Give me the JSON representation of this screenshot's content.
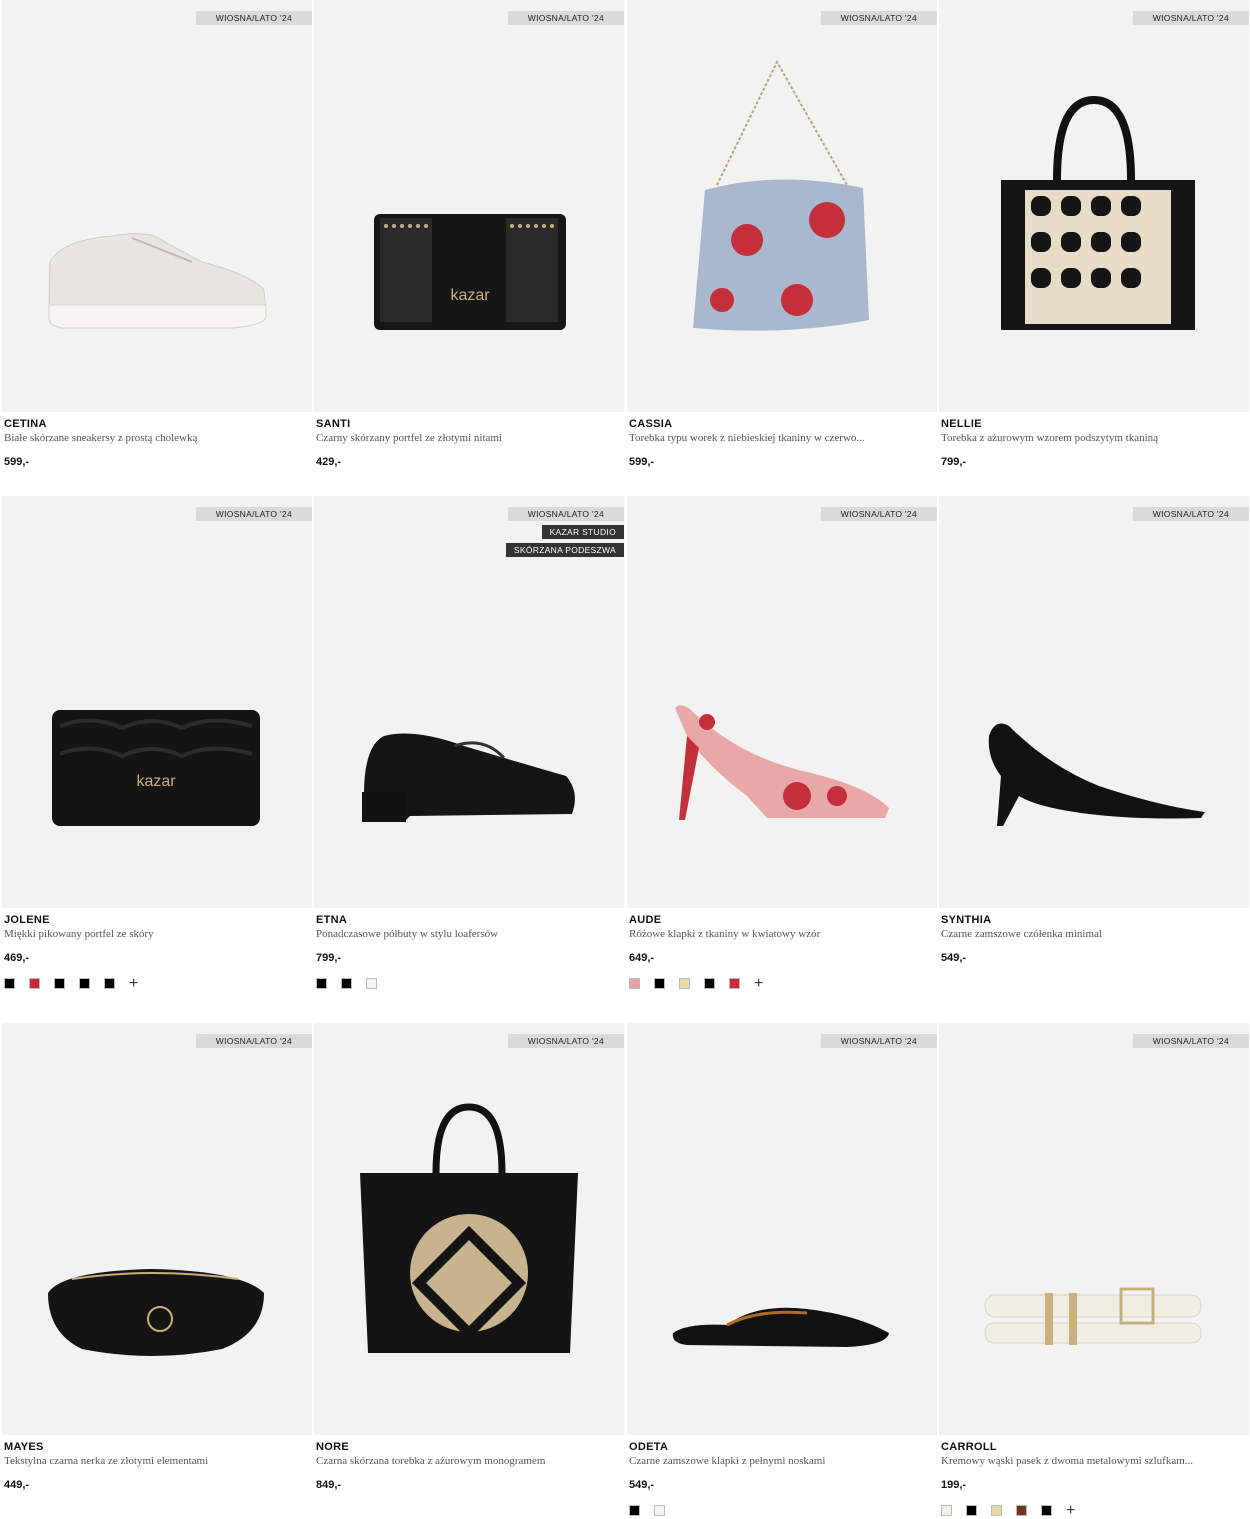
{
  "products": [
    {
      "name": "CETINA",
      "desc": "Białe skórzane sneakersy z prostą cholewką",
      "price": "599,-",
      "badges": [
        "WIOSNA/LATO '24"
      ],
      "swatches": []
    },
    {
      "name": "SANTI",
      "desc": "Czarny skórzany portfel ze złotymi nitami",
      "price": "429,-",
      "badges": [
        "WIOSNA/LATO '24"
      ],
      "swatches": [],
      "logo": "kazar"
    },
    {
      "name": "CASSIA",
      "desc": "Torebka typu worek z niebieskiej tkaniny w czerwo...",
      "price": "599,-",
      "badges": [
        "WIOSNA/LATO '24"
      ],
      "swatches": []
    },
    {
      "name": "NELLIE",
      "desc": "Torebka z ażurowym wzorem podszytym tkaniną",
      "price": "799,-",
      "badges": [
        "WIOSNA/LATO '24"
      ],
      "swatches": []
    },
    {
      "name": "JOLENE",
      "desc": "Miękki pikowany portfel ze skóry",
      "price": "469,-",
      "badges": [
        "WIOSNA/LATO '24"
      ],
      "swatches": [
        "#000000",
        "#c8283a",
        "#000000",
        "#000000",
        "#000000"
      ],
      "more": "+",
      "logo": "kazar"
    },
    {
      "name": "ETNA",
      "desc": "Ponadczasowe półbuty w stylu loafersów",
      "price": "799,-",
      "badges": [
        "WIOSNA/LATO '24",
        "KAZAR STUDIO",
        "SKÓRZANA PODESZWA"
      ],
      "swatches": [
        "#000000",
        "#000000",
        "#f4f4f4"
      ]
    },
    {
      "name": "AUDE",
      "desc": "Różowe klapki z tkaniny w kwiatowy wzór",
      "price": "649,-",
      "badges": [
        "WIOSNA/LATO '24"
      ],
      "swatches": [
        "#e8a0a4",
        "#000000",
        "#e8d9a6",
        "#000000",
        "#c8283a"
      ],
      "more": "+"
    },
    {
      "name": "SYNTHIA",
      "desc": "Czarne zamszowe czółenka minimal",
      "price": "549,-",
      "badges": [
        "WIOSNA/LATO '24"
      ],
      "swatches": []
    },
    {
      "name": "MAYES",
      "desc": "Tekstylna czarna nerka ze złotymi elementami",
      "price": "449,-",
      "badges": [
        "WIOSNA/LATO '24"
      ],
      "swatches": []
    },
    {
      "name": "NORE",
      "desc": "Czarna skórzana torebka z ażurowym monogramem",
      "price": "849,-",
      "badges": [
        "WIOSNA/LATO '24"
      ],
      "swatches": []
    },
    {
      "name": "ODETA",
      "desc": "Czarne zamszowe klapki z pełnymi noskami",
      "price": "549,-",
      "badges": [
        "WIOSNA/LATO '24"
      ],
      "swatches": [
        "#000000",
        "#f4f4f4"
      ]
    },
    {
      "name": "CARROLL",
      "desc": "Kremowy wąski pasek z dwoma metalowymi szlufkam...",
      "price": "199,-",
      "badges": [
        "WIOSNA/LATO '24"
      ],
      "swatches": [
        "#f4f1e6",
        "#000000",
        "#e8d9a6",
        "#6b3a1c",
        "#000000"
      ],
      "more": "+"
    }
  ]
}
